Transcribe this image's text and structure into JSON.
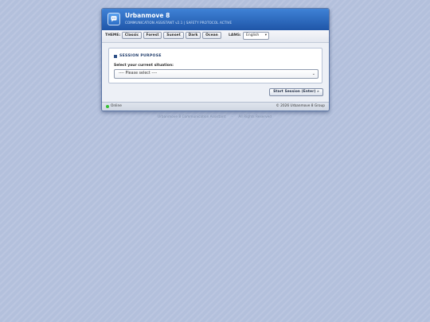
{
  "app": {
    "title": "Urbanmove 8",
    "subtitle": "COMMUNICATION ASSISTANT v2.1  |  SAFETY PROTOCOL ACTIVE",
    "icon": "chat-bubble-icon"
  },
  "toolbar": {
    "theme_label": "THEME:",
    "themes": [
      "Classic",
      "Forest",
      "Sunset",
      "Dark",
      "Ocean"
    ],
    "lang_label": "LANG:",
    "lang_value": "English"
  },
  "panel": {
    "title": "SESSION PURPOSE",
    "field_label": "Select your current situation:",
    "select_value": "---- Please select ----"
  },
  "actions": {
    "start_label": "Start Session (Enter) »"
  },
  "status": {
    "state": "Online",
    "state_color": "#36c136",
    "copyright": "© 2026 Urbanmove 8 Group"
  },
  "footer": {
    "product": "Urbanmove 8 Communication Assistant",
    "rights": "All Rights Reserved"
  },
  "colors": {
    "titlebar": "#2a68bd",
    "background": "#b3c0dc",
    "panel_title": "#1f3b6a"
  }
}
